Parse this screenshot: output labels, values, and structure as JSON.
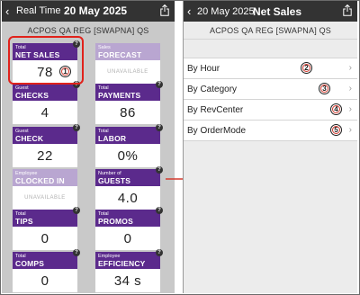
{
  "left": {
    "nav": {
      "back_glyph": "‹",
      "back_label": "Real Time",
      "date": "20 May 2025",
      "share_icon": "share-icon"
    },
    "subtitle": "ACPOS QA REG [SWAPNA] QS",
    "tiles": [
      {
        "small": "Total",
        "big": "NET SALES",
        "value": "78",
        "disabled": false,
        "marker": "1"
      },
      {
        "small": "Sales",
        "big": "FORECAST",
        "value": "UNAVAILABLE",
        "disabled": true
      },
      {
        "small": "Guest",
        "big": "CHECKS",
        "value": "4",
        "disabled": false
      },
      {
        "small": "Total",
        "big": "PAYMENTS",
        "value": "86",
        "disabled": false
      },
      {
        "small": "Guest",
        "big": "CHECK AVERAGE",
        "value": "22",
        "disabled": false
      },
      {
        "small": "Total",
        "big": "LABOR",
        "value": "0%",
        "disabled": false
      },
      {
        "small": "Employee",
        "big": "CLOCKED IN",
        "value": "UNAVAILABLE",
        "disabled": true
      },
      {
        "small": "Number of",
        "big": "GUESTS",
        "value": "4.0",
        "disabled": false
      },
      {
        "small": "Total",
        "big": "TIPS",
        "value": "0",
        "disabled": false
      },
      {
        "small": "Total",
        "big": "PROMOS",
        "value": "0",
        "disabled": false
      },
      {
        "small": "Total",
        "big": "COMPS",
        "value": "0",
        "disabled": false
      },
      {
        "small": "Employee",
        "big": "EFFICIENCY",
        "value": "34 s",
        "disabled": false
      }
    ],
    "help_glyph": "?"
  },
  "right": {
    "nav": {
      "back_glyph": "‹",
      "date": "20 May 2025",
      "title": "Net Sales",
      "share_icon": "share-icon"
    },
    "subtitle": "ACPOS QA REG [SWAPNA] QS",
    "rows": [
      {
        "label": "By Hour",
        "marker": "2"
      },
      {
        "label": "By Category",
        "marker": "3"
      },
      {
        "label": "By RevCenter",
        "marker": "4"
      },
      {
        "label": "By OrderMode",
        "marker": "5"
      }
    ],
    "chevron_glyph": "›"
  },
  "colors": {
    "nav_bg": "#333333",
    "tile_header": "#5b2a8c",
    "tile_header_disabled": "#b9a6d1",
    "highlight": "#e0221b",
    "arrow": "#d43a2f"
  }
}
